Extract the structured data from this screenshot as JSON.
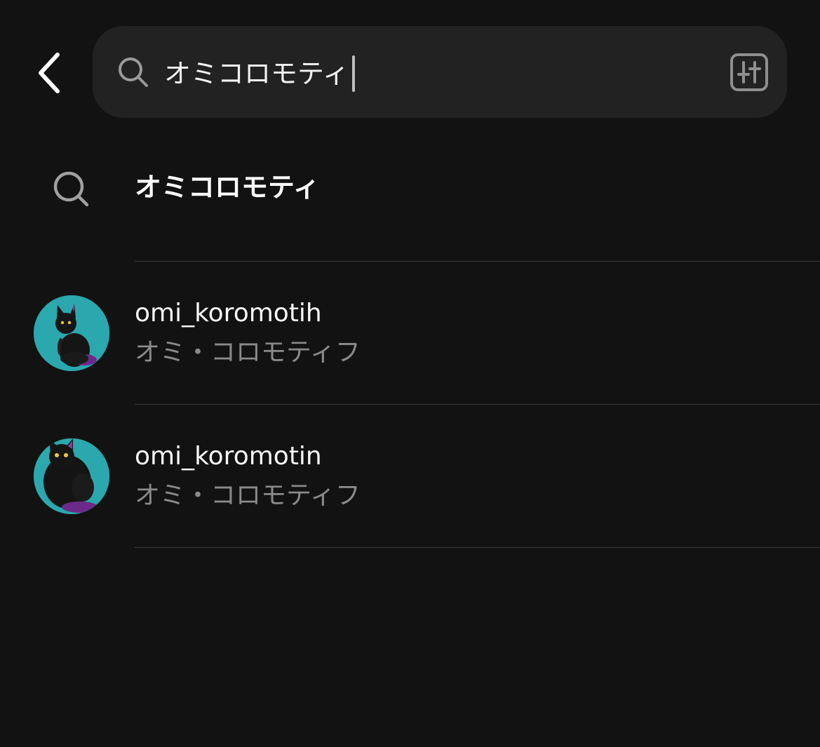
{
  "header": {
    "back_icon": "chevron-left-icon",
    "search": {
      "icon": "search-icon",
      "value": "オミコロモティ",
      "filter_icon": "filter-sliders-icon"
    }
  },
  "suggestion": {
    "icon": "search-icon",
    "text": "オミコロモティ"
  },
  "results": [
    {
      "username": "omi_koromotih",
      "fullname": "オミ・コロモティフ",
      "avatar": "black-cat-avatar"
    },
    {
      "username": "omi_koromotin",
      "fullname": "オミ・コロモティフ",
      "avatar": "black-cat-avatar"
    }
  ],
  "colors": {
    "background": "#121212",
    "search_bar": "#222222",
    "divider": "#3a3a3a",
    "primary_text": "#f7f7f7",
    "secondary_text": "#8a8a8a",
    "avatar_bg": "#2aa8ad"
  }
}
